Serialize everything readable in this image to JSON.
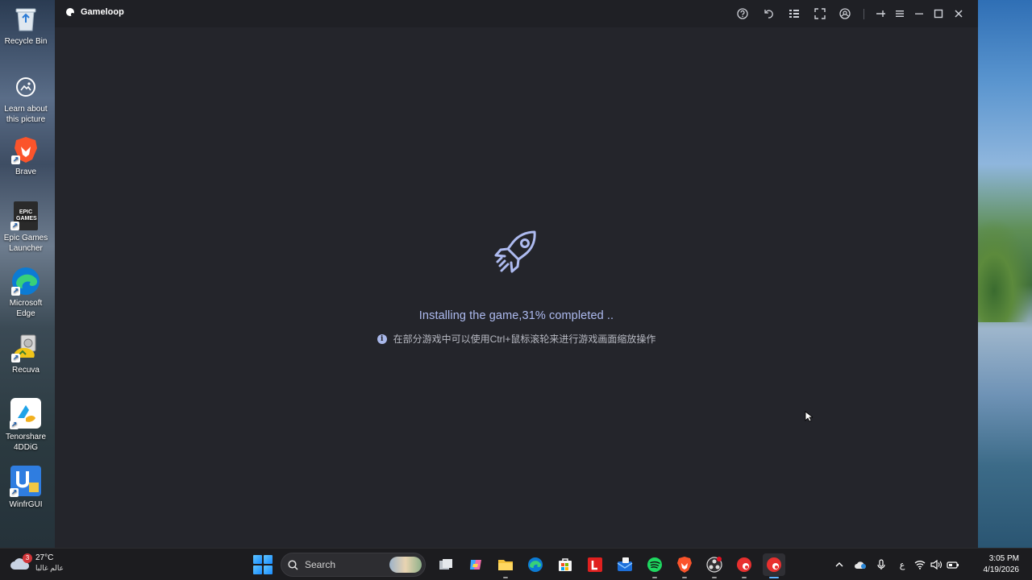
{
  "desktop": {
    "icons": [
      {
        "label": "Recycle Bin",
        "icon": "recycle-bin-icon"
      },
      {
        "label": "Learn about this picture",
        "icon": "camera-icon"
      },
      {
        "label": "Brave",
        "icon": "brave-icon"
      },
      {
        "label": "Epic Games Launcher",
        "icon": "epic-games-icon",
        "logo_text": "EPIC GAMES"
      },
      {
        "label": "Microsoft Edge",
        "icon": "edge-icon"
      },
      {
        "label": "Recuva",
        "icon": "recuva-icon"
      },
      {
        "label": "Tenorshare 4DDiG",
        "icon": "tenorshare-icon"
      },
      {
        "label": "WinfrGUI",
        "icon": "winfrgui-icon"
      }
    ]
  },
  "window": {
    "title": "Gameloop",
    "toolbar_icons": [
      "help-icon",
      "back-icon",
      "apps-grid-icon",
      "fullscreen-icon",
      "gamepad-icon",
      "pin-icon",
      "menu-icon",
      "minimize-icon",
      "maximize-icon",
      "close-icon"
    ],
    "status": "Installing the game,31% completed ..",
    "progress_percent": 31,
    "tip": "在部分游戏中可以使用Ctrl+鼠标滚轮来进行游戏画面缩放操作",
    "accent_color": "#aebbf0"
  },
  "taskbar": {
    "weather": {
      "temp": "27°C",
      "condition": "عالم غالبا",
      "badge": "3"
    },
    "search_placeholder": "Search",
    "apps": [
      "task-view-icon",
      "copilot-icon",
      "file-explorer-icon",
      "edge-icon",
      "store-icon",
      "l-app-icon",
      "mail-icon",
      "spotify-icon",
      "brave-icon",
      "obs-icon",
      "gameloop-icon",
      "gameloop-icon"
    ],
    "tray": {
      "language": "ع"
    },
    "clock": {
      "time": "3:05 PM",
      "date": "4/19/2026"
    }
  }
}
